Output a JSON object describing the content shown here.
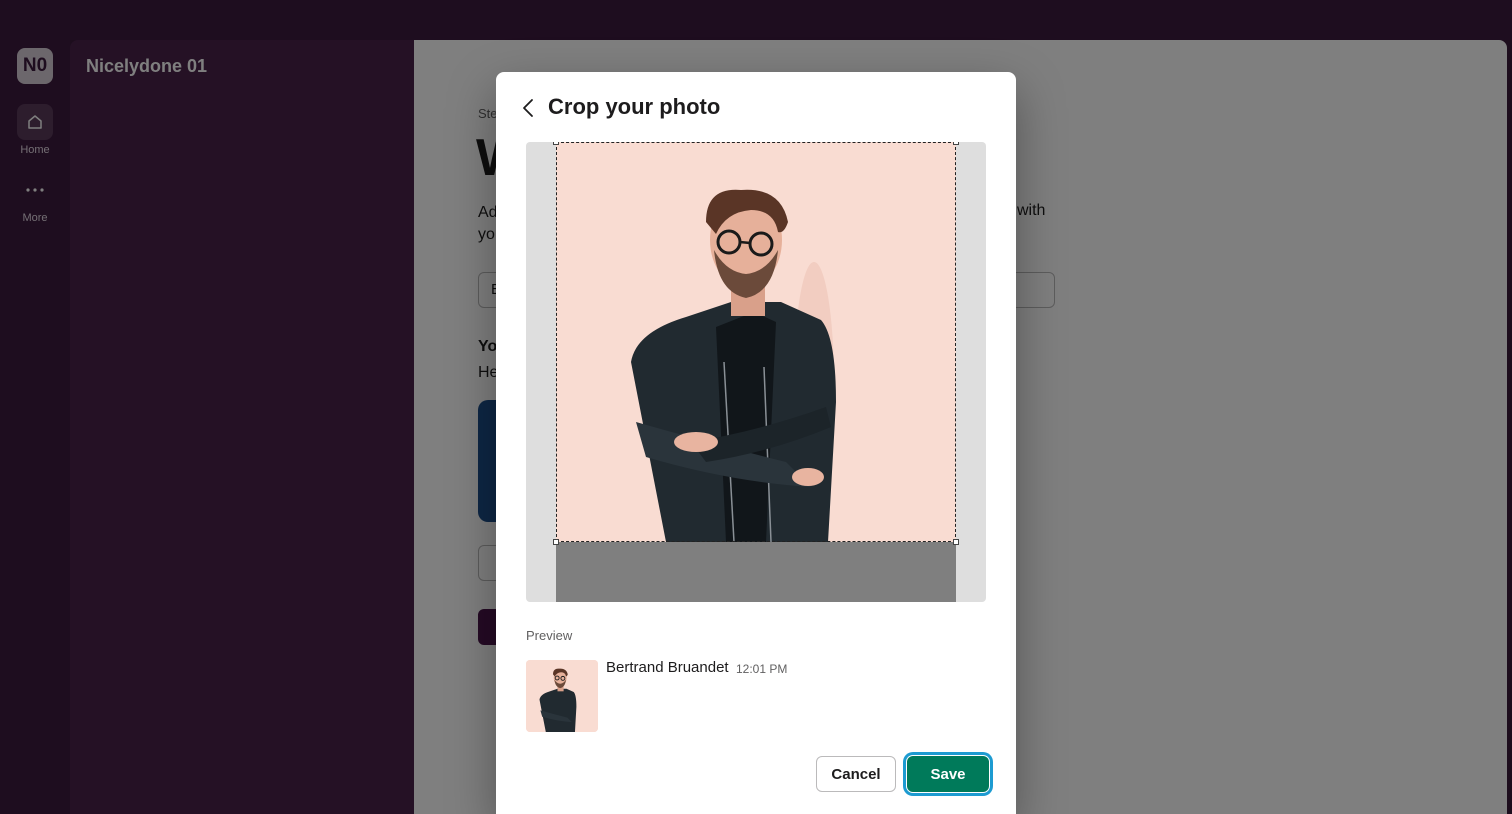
{
  "workspace": {
    "initials": "N0",
    "name": "Nicelydone 01"
  },
  "rail": {
    "home_label": "Home",
    "more_label": "More",
    "home_icon": "home-icon",
    "more_icon": "more-dots-icon"
  },
  "background_page": {
    "step_text": "Ste",
    "title_fragment": "W",
    "desc_line1": "Ad",
    "desc_line2": "yo",
    "desc_tail": "with",
    "input_fragment": "E",
    "photo_heading": "Yo",
    "photo_sub": "He"
  },
  "modal": {
    "title": "Crop your photo",
    "back_icon": "chevron-left-icon",
    "preview_label": "Preview",
    "preview_name": "Bertrand Bruandet",
    "preview_time": "12:01 PM",
    "cancel_label": "Cancel",
    "save_label": "Save"
  },
  "colors": {
    "sidebar": "#4a234b",
    "save_button": "#007a5a",
    "focus_ring": "#1d9bd1",
    "photo_background": "#f9dcd2"
  }
}
